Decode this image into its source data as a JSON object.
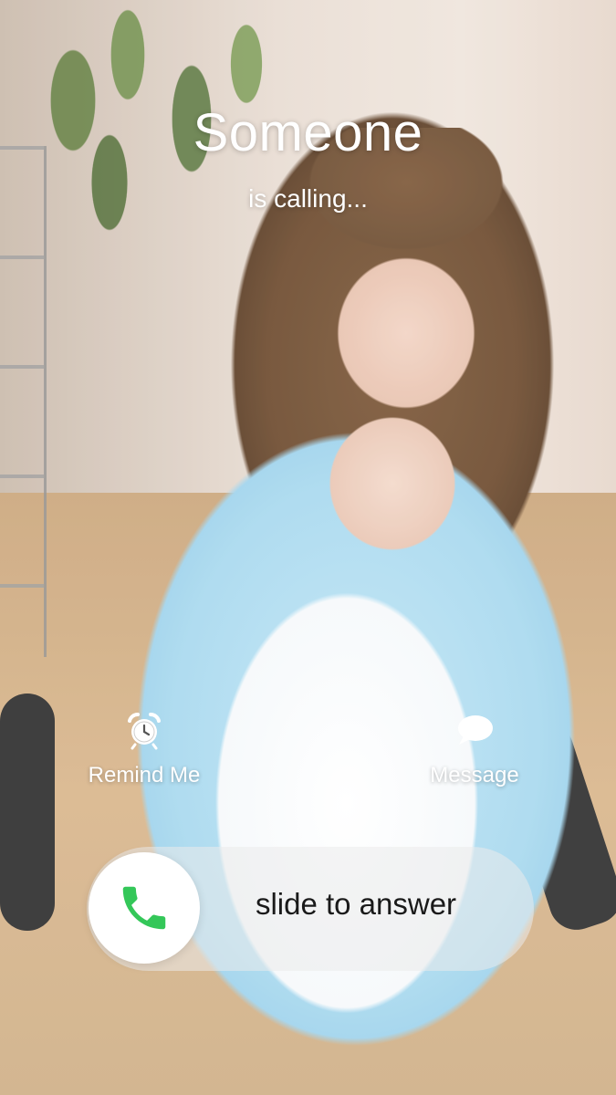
{
  "caller": {
    "name": "Someone",
    "status": "is calling..."
  },
  "actions": {
    "remind": {
      "label": "Remind Me",
      "icon": "alarm-clock-icon"
    },
    "message": {
      "label": "Message",
      "icon": "speech-bubble-icon"
    }
  },
  "answer_slider": {
    "label": "slide to answer",
    "icon": "phone-handset-icon",
    "accent_color": "#34c759"
  }
}
